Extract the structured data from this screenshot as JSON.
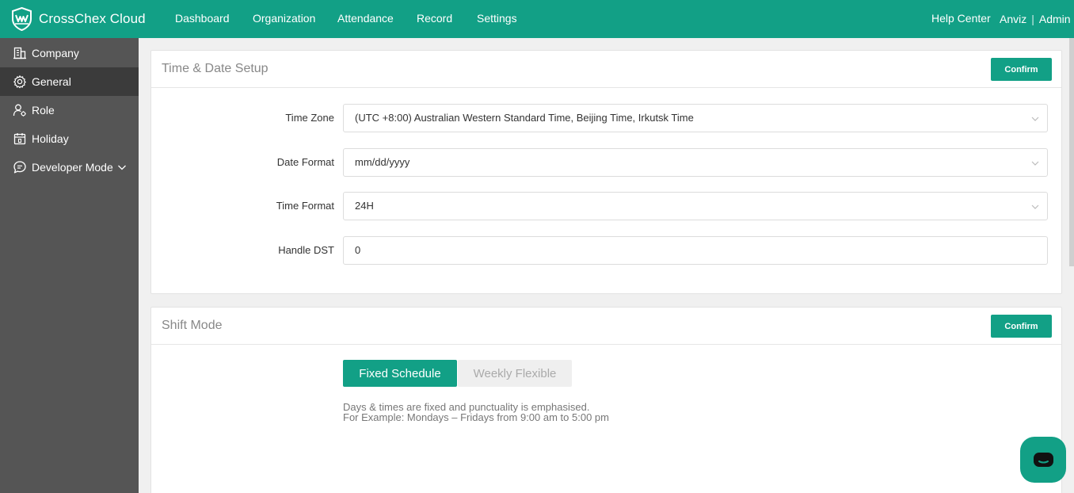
{
  "app": {
    "name": "CrossChex Cloud"
  },
  "nav": {
    "items": [
      {
        "label": "Dashboard"
      },
      {
        "label": "Organization"
      },
      {
        "label": "Attendance"
      },
      {
        "label": "Record"
      },
      {
        "label": "Settings"
      }
    ],
    "help": "Help Center",
    "user": {
      "org": "Anviz",
      "separator": "|",
      "name": "Admin"
    }
  },
  "sidebar": {
    "items": [
      {
        "label": "Company",
        "icon": "building-icon"
      },
      {
        "label": "General",
        "icon": "gear-icon",
        "active": true
      },
      {
        "label": "Role",
        "icon": "user-gear-icon"
      },
      {
        "label": "Holiday",
        "icon": "calendar-icon"
      },
      {
        "label": "Developer Mode",
        "icon": "chat-lines-icon"
      }
    ]
  },
  "time_date": {
    "title": "Time & Date Setup",
    "confirm": "Confirm",
    "fields": [
      {
        "label": "Time Zone",
        "value": "(UTC +8:00) Australian Western Standard Time, Beijing Time, Irkutsk Time",
        "type": "select"
      },
      {
        "label": "Date Format",
        "value": "mm/dd/yyyy",
        "type": "select"
      },
      {
        "label": "Time Format",
        "value": "24H",
        "type": "select"
      },
      {
        "label": "Handle DST",
        "value": "0",
        "type": "input"
      }
    ]
  },
  "shift": {
    "title": "Shift Mode",
    "confirm": "Confirm",
    "options": [
      "Fixed Schedule",
      "Weekly Flexible"
    ],
    "selected": "Fixed Schedule",
    "description_line1": "Days & times are fixed and punctuality is emphasised.",
    "description_line2": "For Example: Mondays – Fridays from 9:00 am to 5:00 pm"
  },
  "colors": {
    "primary": "#12a086",
    "sidebar": "#555555",
    "sidebar_active": "#3b3b3b"
  }
}
